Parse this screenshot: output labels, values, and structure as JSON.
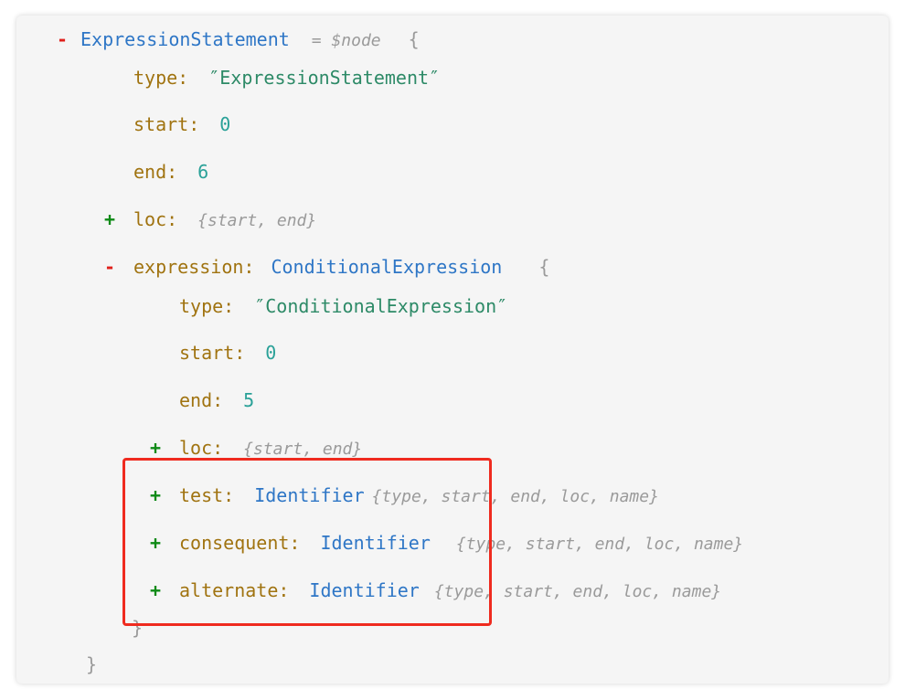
{
  "tree": {
    "root": {
      "toggle": "-",
      "name": "ExpressionStatement",
      "meta": "= $node",
      "open_brace": "{"
    },
    "type": {
      "key": "type:",
      "value": "″ExpressionStatement″"
    },
    "start": {
      "key": "start:",
      "value": "0"
    },
    "end": {
      "key": "end:",
      "value": "6"
    },
    "loc": {
      "toggle": "+",
      "key": "loc:",
      "summary": "{start, end}"
    },
    "expression": {
      "toggle": "-",
      "key": "expression:",
      "name": "ConditionalExpression",
      "open_brace": "{",
      "type": {
        "key": "type:",
        "value": "″ConditionalExpression″"
      },
      "start": {
        "key": "start:",
        "value": "0"
      },
      "end": {
        "key": "end:",
        "value": "5"
      },
      "loc": {
        "toggle": "+",
        "key": "loc:",
        "summary": "{start, end}"
      },
      "test": {
        "toggle": "+",
        "key": "test:",
        "name": "Identifier",
        "summary": "{type, start, end, loc, name}"
      },
      "consequent": {
        "toggle": "+",
        "key": "consequent:",
        "name": "Identifier",
        "summary": "{type, start, end, loc, name}"
      },
      "alternate": {
        "toggle": "+",
        "key": "alternate:",
        "name": "Identifier",
        "summary": "{type, start, end, loc, name}"
      },
      "close_brace": "}"
    },
    "close_brace": "}"
  },
  "colors": {
    "collapse": "#e0201b",
    "expand": "#0e8a16",
    "key": "#a07310",
    "number": "#2aa198",
    "string": "#2d8a67",
    "type_name": "#2e76c6",
    "highlight_box": "#ef2b1f"
  }
}
